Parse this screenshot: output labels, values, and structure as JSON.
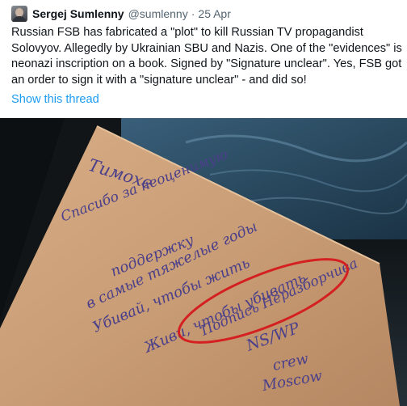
{
  "tweet": {
    "display_name": "Sergej Sumlenny",
    "handle": "@sumlenny",
    "separator": "·",
    "date": "25 Apr",
    "text": "Russian FSB has fabricated a \"plot\" to kill Russian TV propagandist Solovyov. Allegedly by Ukrainian SBU and Nazis. One of the \"evidences\" is neonazi inscription on a book. Signed by \"Signature unclear\". Yes, FSB got an order to sign it with a \"signature unclear\" - and did so!",
    "show_thread": "Show this thread"
  },
  "media": {
    "handwriting_lines": [
      "Тимохе",
      "Спасибо за неоценимую",
      "поддержку",
      "в самые тяжелые годы",
      "Убивай, чтобы жить",
      "Живи, чтобы убивать",
      "Подпись Неразборчива",
      "NS/WP",
      "crew",
      "Moscow"
    ],
    "ink_color": "#4a3f8a",
    "circle_color": "#d42020",
    "paper_color": "#c79b73"
  }
}
